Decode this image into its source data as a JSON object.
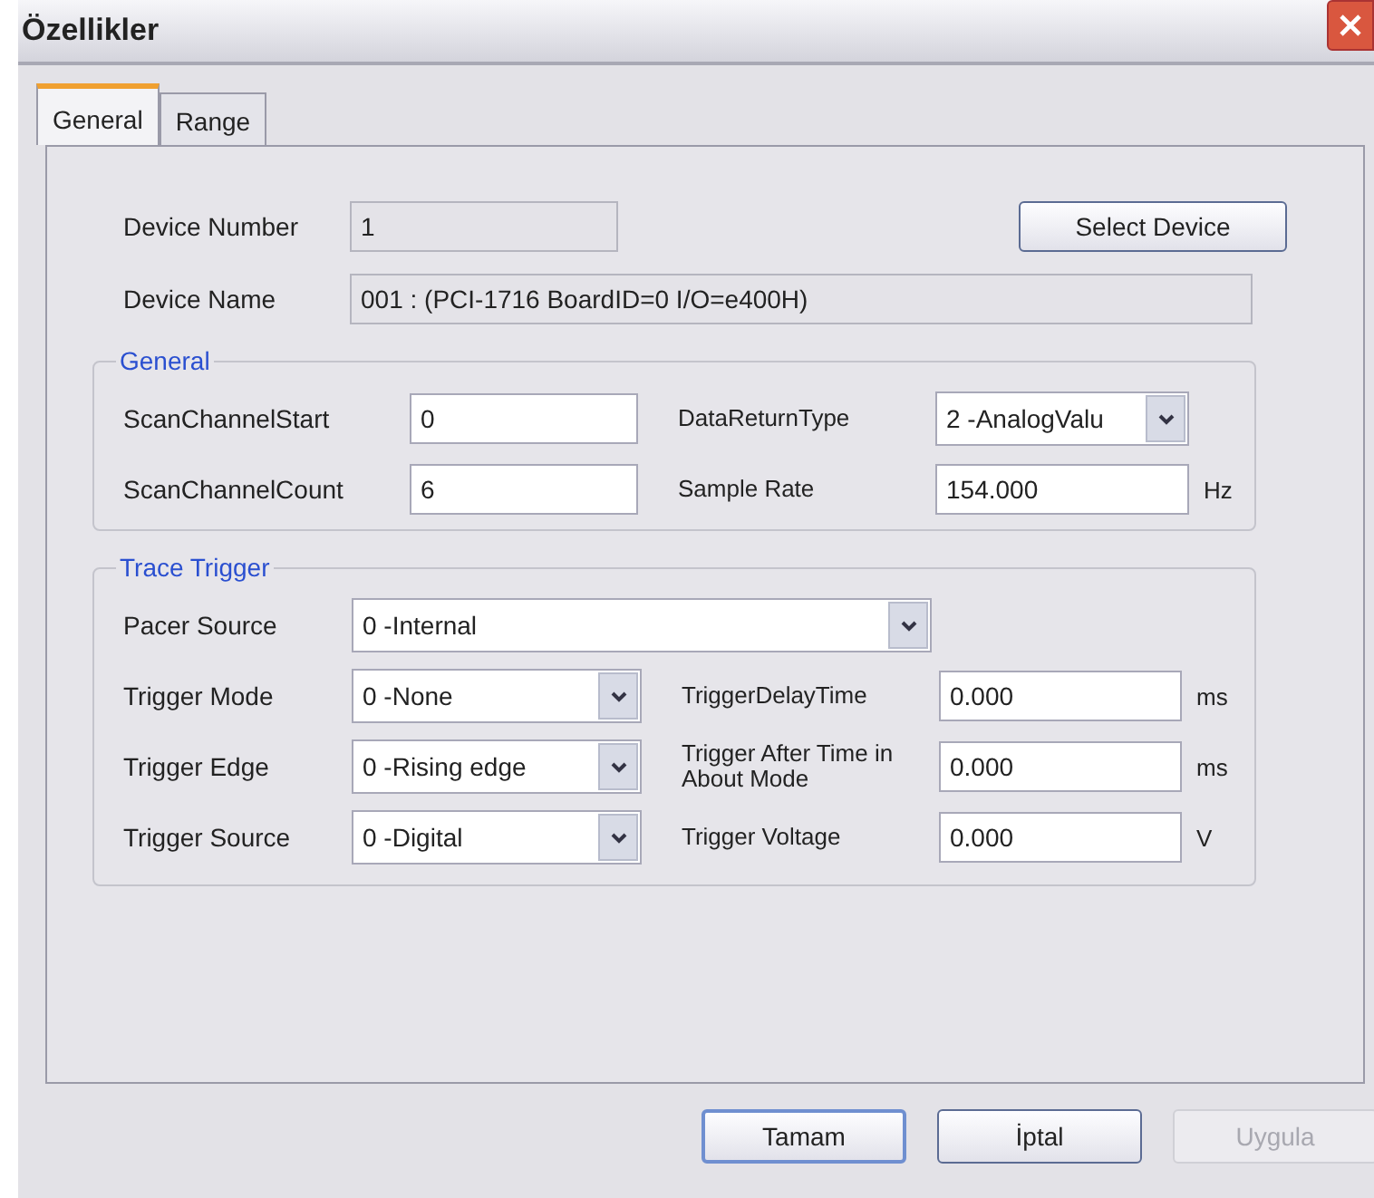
{
  "window": {
    "title": "Özellikler"
  },
  "tabs": [
    {
      "label": "General",
      "selected": true
    },
    {
      "label": "Range",
      "selected": false
    }
  ],
  "device": [
    {
      "label": "Device Number",
      "kind": "readonly",
      "value": "1",
      "button": "Select Device"
    },
    {
      "label": "Device Name",
      "kind": "readonly",
      "value": "001 : (PCI-1716 BoardID=0 I/O=e400H)"
    }
  ],
  "groups": [
    {
      "title": "General",
      "rows": [
        [
          {
            "label": "ScanChannelStart",
            "kind": "text",
            "value": "0"
          },
          {
            "label": "DataReturnType",
            "kind": "combo",
            "value": "2 -AnalogValu"
          }
        ],
        [
          {
            "label": "ScanChannelCount",
            "kind": "text",
            "value": "6"
          },
          {
            "label": "Sample Rate",
            "kind": "text",
            "value": "154.000",
            "unit": "Hz"
          }
        ]
      ]
    },
    {
      "title": "Trace Trigger",
      "rows": [
        [
          {
            "label": "Pacer Source",
            "kind": "combo",
            "value": "0 -Internal"
          }
        ],
        [
          {
            "label": "Trigger Mode",
            "kind": "combo",
            "value": "0 -None"
          },
          {
            "label": "TriggerDelayTime",
            "kind": "text",
            "value": "0.000",
            "unit": "ms"
          }
        ],
        [
          {
            "label": "Trigger Edge",
            "kind": "combo",
            "value": "0 -Rising edge"
          },
          {
            "label": "Trigger After Time in About Mode",
            "kind": "text",
            "value": "0.000",
            "unit": "ms"
          }
        ],
        [
          {
            "label": "Trigger Source",
            "kind": "combo",
            "value": "0 -Digital"
          },
          {
            "label": "Trigger Voltage",
            "kind": "text",
            "value": "0.000",
            "unit": "V"
          }
        ]
      ]
    }
  ],
  "buttons": [
    {
      "label": "Tamam",
      "default": true,
      "disabled": false
    },
    {
      "label": "İptal",
      "default": false,
      "disabled": false
    },
    {
      "label": "Uygula",
      "default": false,
      "disabled": true
    }
  ]
}
